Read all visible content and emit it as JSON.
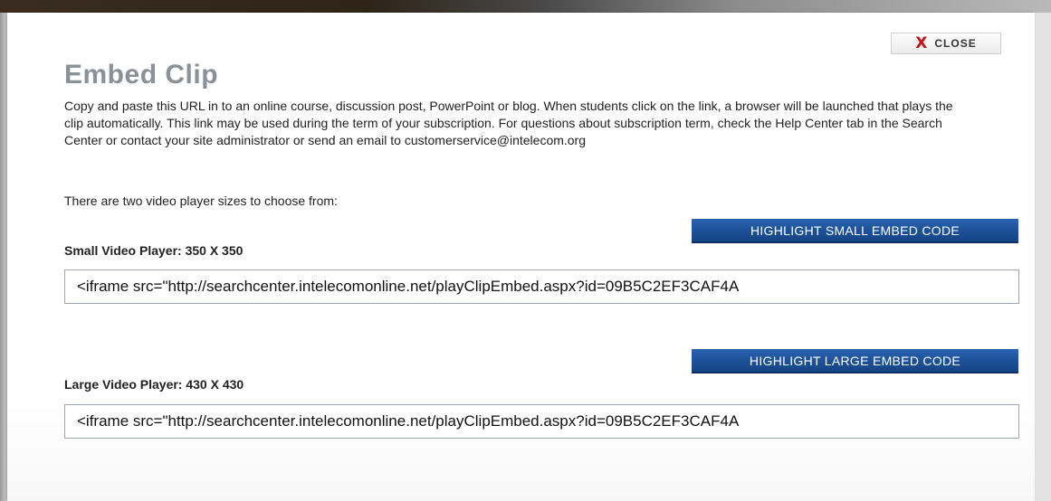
{
  "dialog": {
    "close_label": "CLOSE",
    "close_icon": "X",
    "title": "Embed Clip",
    "description": "Copy and paste this URL in to an online course, discussion post, PowerPoint or blog. When students click on the link, a browser will be launched that plays the clip automatically. This link may be used during the term of your subscription. For questions about subscription term, check the Help Center tab in the Search Center or contact your site administrator or send an email to customerservice@intelecom.org",
    "choose_text": "There are two video player sizes to choose from:"
  },
  "small_player": {
    "button_label": "HIGHLIGHT SMALL EMBED CODE",
    "label": "Small Video Player: 350 X 350",
    "code": "<iframe src=\"http://searchcenter.intelecomonline.net/playClipEmbed.aspx?id=09B5C2EF3CAF4A"
  },
  "large_player": {
    "button_label": "HIGHLIGHT LARGE EMBED CODE",
    "label": "Large Video Player: 430 X 430",
    "code": "<iframe src=\"http://searchcenter.intelecomonline.net/playClipEmbed.aspx?id=09B5C2EF3CAF4A"
  },
  "colors": {
    "accent_blue": "#1b4f95",
    "close_red": "#c3121a",
    "title_gray": "#8a9198"
  }
}
